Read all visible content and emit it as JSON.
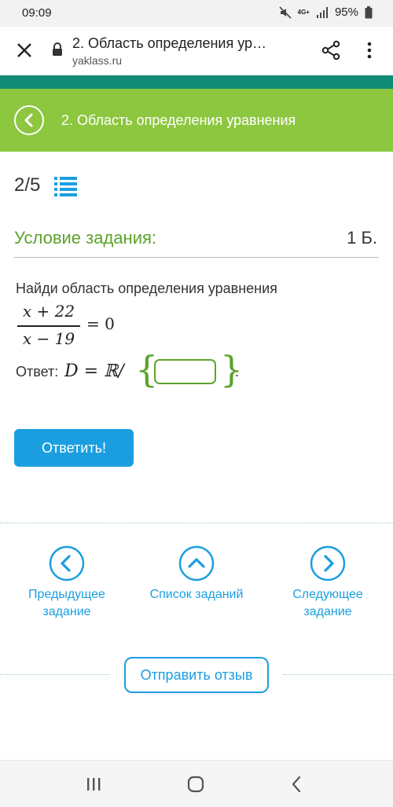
{
  "status_bar": {
    "time": "09:09",
    "network": "4G+",
    "battery": "95%"
  },
  "browser": {
    "page_title": "2. Область определения ур…",
    "domain": "yaklass.ru"
  },
  "header": {
    "title": "2. Область определения уравнения"
  },
  "progress": {
    "counter": "2/5"
  },
  "condition": {
    "title": "Условие задания:",
    "points": "1 Б."
  },
  "task": {
    "prompt": "Найди область определения уравнения",
    "numerator": "x + 22",
    "denominator": "x − 19",
    "equals": "= 0",
    "answer_label": "Ответ:",
    "answer_math": "D = ℝ/",
    "answer_value": ""
  },
  "submit_label": "Ответить!",
  "nav": {
    "prev_label": "Предыдущее задание",
    "list_label": "Список заданий",
    "next_label": "Следующее задание"
  },
  "feedback_label": "Отправить отзыв",
  "colors": {
    "green": "#8dc63f",
    "teal": "#118b75",
    "blue": "#1b9ee0",
    "answer_green": "#5ba32b"
  }
}
